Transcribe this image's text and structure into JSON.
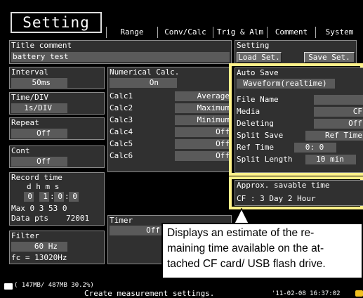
{
  "header": {
    "screen_title": "Setting",
    "tabs": [
      "Range",
      "Conv/Calc",
      "Trig & Alm",
      "Comment",
      "System"
    ]
  },
  "title_comment": {
    "label": "Title comment",
    "value": "battery test"
  },
  "setting": {
    "label": "Setting",
    "load_button": "Load Set.",
    "save_button": "Save Set."
  },
  "interval": {
    "label": "Interval",
    "value": "50ms"
  },
  "time_div": {
    "label": "Time/DIV",
    "value": "1s/DIV"
  },
  "repeat": {
    "label": "Repeat",
    "value": "Off"
  },
  "cont": {
    "label": "Cont",
    "value": "Off"
  },
  "record_time": {
    "label": "Record time",
    "header": "d  h  m  s",
    "d": "0",
    "h": "1",
    "m": "0",
    "s": "0",
    "max_line": "Max  0  3 53  0",
    "data_pts_label": "Data pts",
    "data_pts_value": "72001"
  },
  "filter": {
    "label": "Filter",
    "value": "60 Hz",
    "fc": "fc = 13020Hz"
  },
  "numerical_calc": {
    "label": "Numerical Calc.",
    "value": "On",
    "rows": [
      {
        "name": "Calc1",
        "value": "Average"
      },
      {
        "name": "Calc2",
        "value": "Maximum"
      },
      {
        "name": "Calc3",
        "value": "Minimum"
      },
      {
        "name": "Calc4",
        "value": "Off"
      },
      {
        "name": "Calc5",
        "value": "Off"
      },
      {
        "name": "Calc6",
        "value": "Off"
      }
    ]
  },
  "timer": {
    "label": "Timer",
    "value": "Off"
  },
  "auto_save": {
    "label": "Auto Save",
    "mode": "Waveform(realtime)",
    "file_name_label": "File Name",
    "file_name_value": "",
    "media_label": "Media",
    "media_value": "CF",
    "deleting_label": "Deleting",
    "deleting_value": "Off",
    "split_save_label": "Split Save",
    "split_save_value": "Ref Time",
    "ref_time_label": "Ref Time",
    "ref_time_value": "0: 0",
    "split_length_label": "Split Length",
    "split_length_value": "10 min"
  },
  "approx": {
    "label": "Approx. savable time",
    "value": "CF : 3 Day 2 Hour"
  },
  "status": {
    "storage": "( 147MB/ 487MB 30.2%)",
    "message": "Create measurement settings.",
    "datetime": "'11-02-08 16:37:02"
  },
  "callout": {
    "line1": "Displays an estimate of the re-",
    "line2": "maining time available on the at-",
    "line3": "tached CF card/ USB flash drive."
  },
  "colors": {
    "highlight": "#fff28a",
    "panel": "#303030",
    "field": "#5a5a5a",
    "background": "#000000"
  }
}
